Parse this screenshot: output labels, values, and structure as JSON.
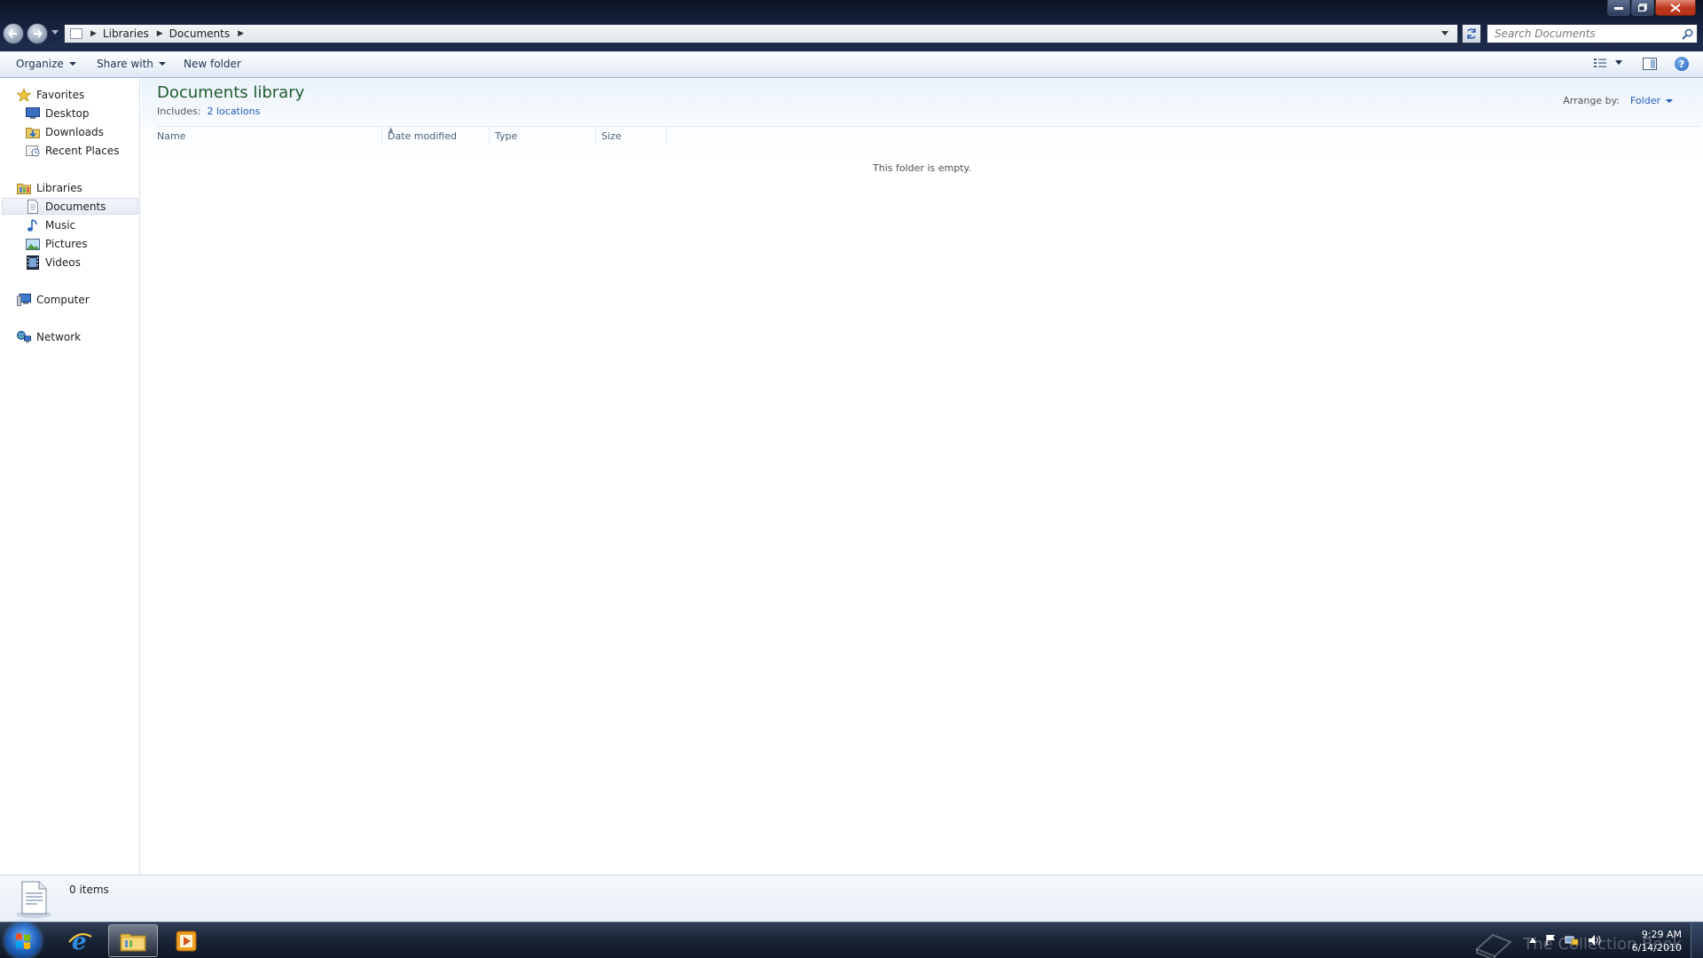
{
  "address_bar": {
    "crumbs": [
      "Libraries",
      "Documents"
    ],
    "search_placeholder": "Search Documents"
  },
  "command_bar": {
    "organize": "Organize",
    "share_with": "Share with",
    "new_folder": "New folder"
  },
  "nav": {
    "favorites": "Favorites",
    "desktop": "Desktop",
    "downloads": "Downloads",
    "recent": "Recent Places",
    "libraries": "Libraries",
    "documents": "Documents",
    "music": "Music",
    "pictures": "Pictures",
    "videos": "Videos",
    "computer": "Computer",
    "network": "Network",
    "selected": "Documents"
  },
  "content": {
    "title": "Documents library",
    "includes_label": "Includes:",
    "includes_link": "2 locations",
    "arrange_label": "Arrange by:",
    "arrange_value": "Folder",
    "columns": [
      "Name",
      "Date modified",
      "Type",
      "Size"
    ],
    "empty_message": "This folder is empty."
  },
  "details": {
    "count": "0 items"
  },
  "taskbar": {
    "time": "9:29 AM",
    "date": "6/14/2010",
    "watermark": "The Collection Book",
    "apps": [
      "internet-explorer",
      "windows-explorer",
      "media-player"
    ]
  },
  "colors": {
    "title_green": "#1e5b2c",
    "link_blue": "#1f5bb6"
  }
}
